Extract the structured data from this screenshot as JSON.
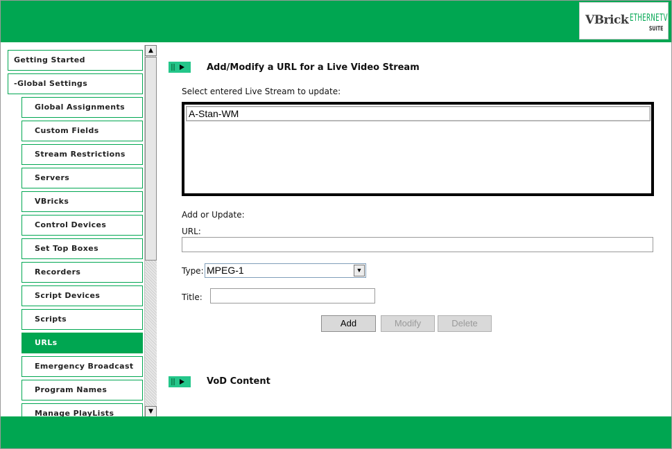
{
  "header": {
    "logo_brand": "VBrick",
    "logo_product": "ETHERNETV",
    "logo_suite": "SUITE"
  },
  "sidebar": {
    "items": [
      {
        "label": "Getting Started",
        "level": "top",
        "active": false
      },
      {
        "label": "-Global Settings",
        "level": "top",
        "active": false
      },
      {
        "label": "Global Assignments",
        "level": "sub",
        "active": false
      },
      {
        "label": "Custom Fields",
        "level": "sub",
        "active": false
      },
      {
        "label": "Stream Restrictions",
        "level": "sub",
        "active": false
      },
      {
        "label": "Servers",
        "level": "sub",
        "active": false
      },
      {
        "label": "VBricks",
        "level": "sub",
        "active": false
      },
      {
        "label": "Control Devices",
        "level": "sub",
        "active": false
      },
      {
        "label": "Set Top Boxes",
        "level": "sub",
        "active": false
      },
      {
        "label": "Recorders",
        "level": "sub",
        "active": false
      },
      {
        "label": "Script Devices",
        "level": "sub",
        "active": false
      },
      {
        "label": "Scripts",
        "level": "sub",
        "active": false
      },
      {
        "label": "URLs",
        "level": "sub",
        "active": true
      },
      {
        "label": "Emergency Broadcast",
        "level": "sub",
        "active": false
      },
      {
        "label": "Program Names",
        "level": "sub",
        "active": false
      },
      {
        "label": "Manage PlayLists",
        "level": "sub",
        "active": false
      }
    ],
    "scroll_up": "▲",
    "scroll_down": "▼"
  },
  "main": {
    "live_section_title": "Add/Modify a URL for a Live Video Stream",
    "select_label": "Select entered Live Stream to update:",
    "streams": [
      "A-Stan-WM"
    ],
    "add_update_label": "Add or Update:",
    "url_label": "URL:",
    "url_value": "",
    "type_label": "Type:",
    "type_value": "MPEG-1",
    "title_label": "Title:",
    "title_value": "",
    "buttons": {
      "add": "Add",
      "modify": "Modify",
      "delete": "Delete"
    },
    "vod_section_title": "VoD Content"
  },
  "colors": {
    "brand_green": "#00a651",
    "section_icon": "#24c68a"
  }
}
